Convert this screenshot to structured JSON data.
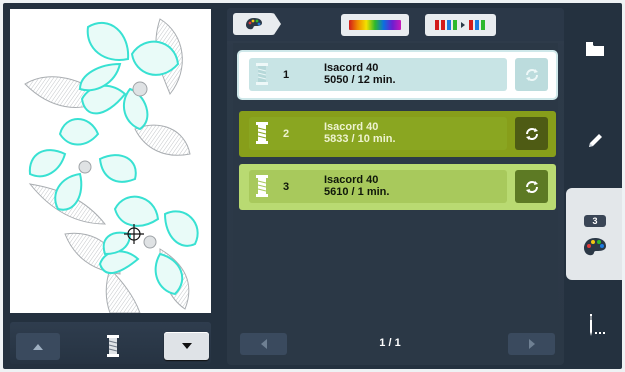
{
  "header": {
    "color_button_icon": "rainbow-color-bar-icon",
    "sort_button_icon": "thread-sort-icon",
    "palette_tab_icon": "palette-icon"
  },
  "threads": [
    {
      "index": "1",
      "brand": "Isacord 40",
      "detail": "5050 / 12 min.",
      "state": "selected"
    },
    {
      "index": "2",
      "brand": "Isacord 40",
      "detail": "5833 / 10 min.",
      "state": "normal"
    },
    {
      "index": "3",
      "brand": "Isacord 40",
      "detail": "5610 / 1 min.",
      "state": "normal"
    }
  ],
  "pagination": {
    "label": "1 / 1"
  },
  "rail": {
    "badge": "3",
    "items": [
      "folder-icon",
      "pencil-icon",
      "palette-icon",
      "needle-threader-icon"
    ]
  },
  "colors": {
    "row1": "#c8e4e5",
    "row2": "#8aa621",
    "row3": "#a8c95c",
    "stitch_cyan": "#38e1d2",
    "stitch_gray": "#b9bcbf"
  }
}
